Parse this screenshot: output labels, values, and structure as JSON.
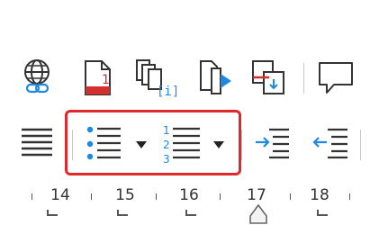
{
  "toolbar_row1": {
    "icons": [
      "globe-link-icon",
      "pdf-document-icon",
      "copy-pages-icon",
      "export-slide-icon",
      "insert-page-icon",
      "comment-icon"
    ],
    "pdf_badge": "1",
    "copy_badge": "[i]"
  },
  "toolbar_row2": {
    "icons": [
      "align-justify-icon",
      "bullet-list-icon",
      "dropdown-arrow-icon",
      "numbered-list-icon",
      "dropdown-arrow-icon",
      "increase-indent-icon",
      "decrease-indent-icon"
    ],
    "numbered_list_digits": [
      "1",
      "2",
      "3"
    ]
  },
  "ruler": {
    "labels": [
      "14",
      "15",
      "16",
      "17",
      "18"
    ]
  },
  "colors": {
    "highlight": "#e0282a",
    "accent_blue": "#1e88e5",
    "icon_dark": "#333333",
    "pdf_red": "#d32f2f"
  }
}
